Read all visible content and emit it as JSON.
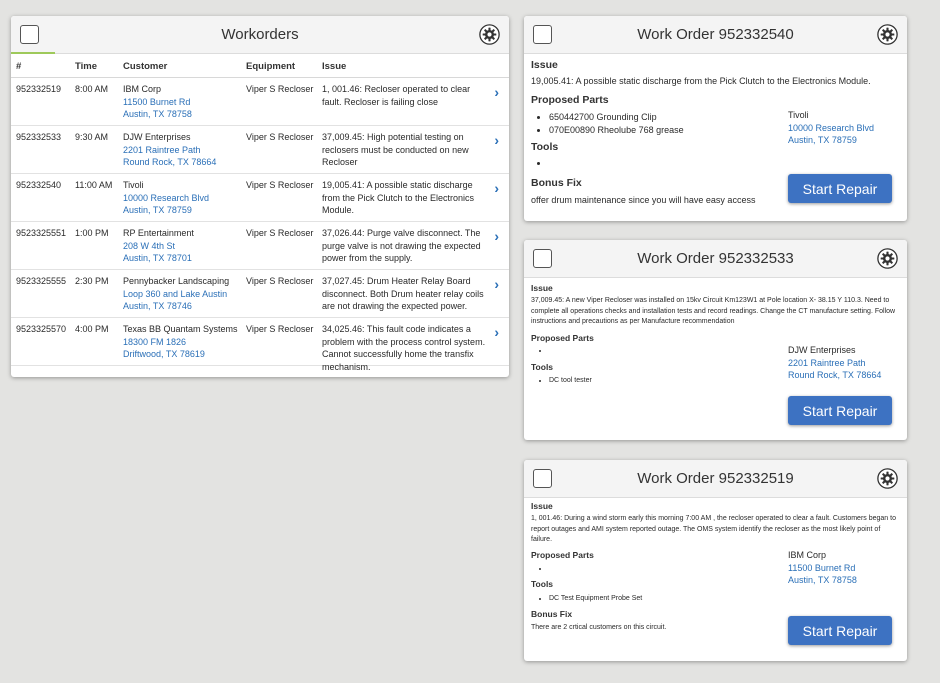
{
  "list": {
    "title": "Workorders",
    "columns": [
      "#",
      "Time",
      "Customer",
      "Equipment",
      "Issue"
    ],
    "rows": [
      {
        "id": "952332519",
        "time": "8:00 AM",
        "customer": "IBM Corp",
        "addr1": "11500 Burnet Rd",
        "addr2": "Austin, TX 78758",
        "equipment": "Viper S Recloser",
        "issue": "1, 001.46: Recloser operated to clear fault. Recloser is failing close"
      },
      {
        "id": "952332533",
        "time": "9:30 AM",
        "customer": "DJW Enterprises",
        "addr1": "2201 Raintree Path",
        "addr2": "Round Rock, TX 78664",
        "equipment": "Viper S Recloser",
        "issue": "37,009.45: High potential testing on reclosers must be conducted on new Recloser"
      },
      {
        "id": "952332540",
        "time": "11:00 AM",
        "customer": "Tivoli",
        "addr1": "10000 Research Blvd",
        "addr2": "Austin, TX 78759",
        "equipment": "Viper S Recloser",
        "issue": "19,005.41: A possible static discharge from the Pick Clutch to the Electronics Module."
      },
      {
        "id": "9523325551",
        "time": "1:00 PM",
        "customer": "RP Entertainment",
        "addr1": "208 W 4th St",
        "addr2": "Austin, TX 78701",
        "equipment": "Viper S Recloser",
        "issue": "37,026.44: Purge valve disconnect. The purge valve is not drawing the expected power from the supply."
      },
      {
        "id": "9523325555",
        "time": "2:30 PM",
        "customer": "Pennybacker Landscaping",
        "addr1": "Loop 360 and Lake Austin",
        "addr2": "Austin, TX 78746",
        "equipment": "Viper S Recloser",
        "issue": "37,027.45: Drum Heater Relay Board disconnect. Both Drum heater relay coils are not drawing the expected power."
      },
      {
        "id": "9523325570",
        "time": "4:00 PM",
        "customer": "Texas BB Quantam Systems",
        "addr1": "18300 FM 1826",
        "addr2": "Driftwood, TX 78619",
        "equipment": "Viper S Recloser",
        "issue": "34,025.46: This fault code indicates a problem with the process control system. Cannot successfully home the transfix mechanism."
      }
    ]
  },
  "d1": {
    "title": "Work Order 952332540",
    "issue_label": "Issue",
    "issue": "19,005.41: A possible static discharge from the Pick Clutch to the Electronics Module.",
    "parts_label": "Proposed Parts",
    "parts": [
      "650442700 Grounding Clip",
      "070E00890 Rheolube 768 grease"
    ],
    "tools_label": "Tools",
    "bonus_label": "Bonus Fix",
    "bonus": "offer drum maintenance since you will have easy access",
    "customer": "Tivoli",
    "addr1": "10000 Research Blvd",
    "addr2": "Austin, TX 78759",
    "button": "Start Repair"
  },
  "d2": {
    "title": "Work Order 952332533",
    "issue_label": "Issue",
    "issue": "37,009.45: A new Viper Recloser was installed on 15kv Circuit Km123W1 at Pole location X- 38.15 Y 110.3. Need to complete all operations checks and installation tests and record readings. Change the CT manufacture setting. Follow instructions and precautions as per Manufacture recommendation",
    "parts_label": "Proposed Parts",
    "tools_label": "Tools",
    "tools": [
      "DC tool tester"
    ],
    "customer": "DJW Enterprises",
    "addr1": "2201 Raintree Path",
    "addr2": "Round Rock, TX 78664",
    "button": "Start Repair"
  },
  "d3": {
    "title": "Work Order 952332519",
    "issue_label": "Issue",
    "issue": "1, 001.46: During a wind storm early this morning 7:00 AM , the recloser operated to clear a fault. Customers began to report outages and AMI system reported outage. The OMS system identify the recloser as the most likely point of failure.",
    "parts_label": "Proposed Parts",
    "tools_label": "Tools",
    "tools": [
      "DC Test Equipment Probe Set"
    ],
    "bonus_label": "Bonus Fix",
    "bonus": "There are 2 crtical customers on this circuit.",
    "customer": "IBM Corp",
    "addr1": "11500 Burnet Rd",
    "addr2": "Austin, TX 78758",
    "button": "Start Repair"
  },
  "icons": {
    "settings": "gear-icon",
    "select": "checkbox",
    "open": "chevron-right-icon"
  },
  "colors": {
    "link": "#2a6fb7",
    "button": "#3d72c2",
    "accent": "#9ec95a",
    "background": "#e3e3e1"
  }
}
